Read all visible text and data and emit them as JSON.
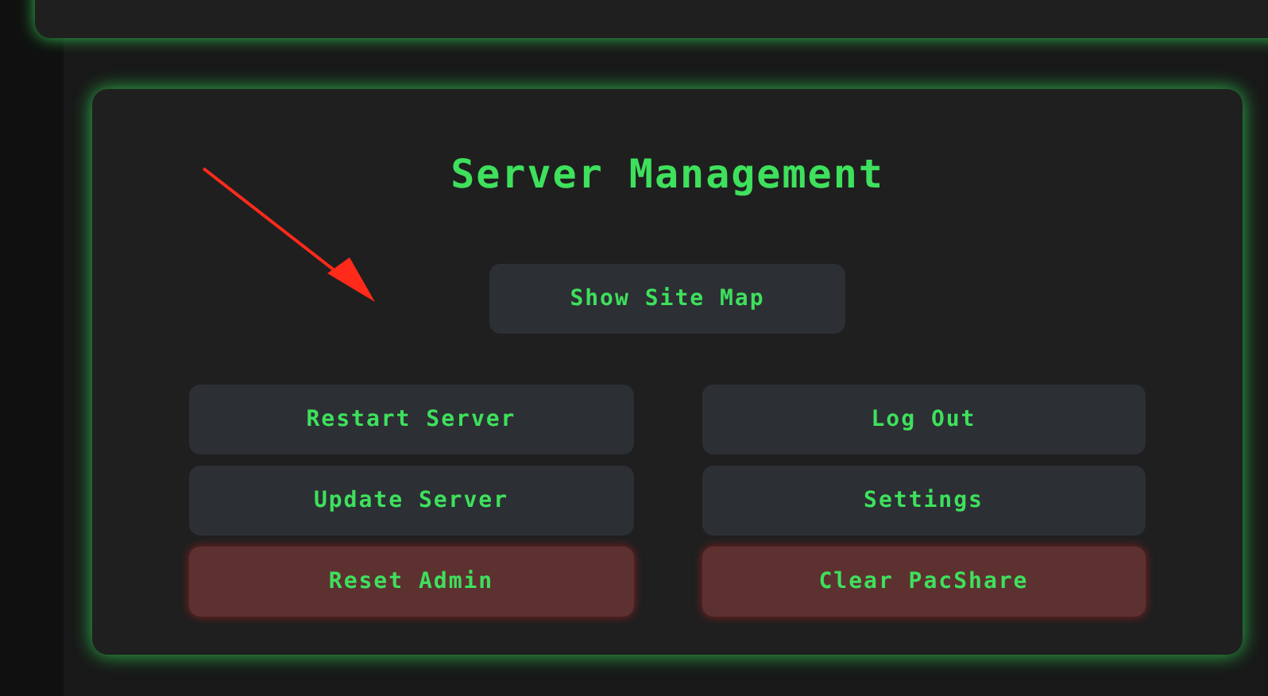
{
  "panel": {
    "title": "Server Management",
    "primary_button": "Show Site Map",
    "buttons": [
      {
        "label": "Restart Server",
        "kind": "normal"
      },
      {
        "label": "Log Out",
        "kind": "normal"
      },
      {
        "label": "Update Server",
        "kind": "normal"
      },
      {
        "label": "Settings",
        "kind": "normal"
      },
      {
        "label": "Reset Admin",
        "kind": "danger"
      },
      {
        "label": "Clear PacShare",
        "kind": "danger"
      }
    ]
  }
}
